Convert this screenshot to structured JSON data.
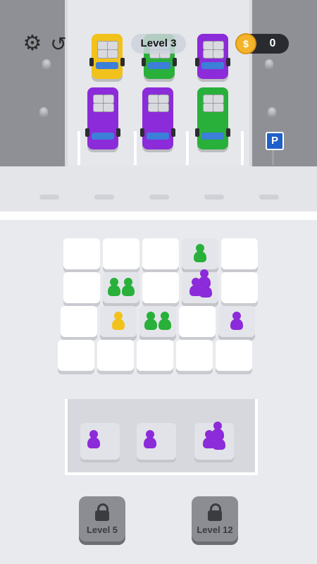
{
  "hud": {
    "settings_icon": "gear-icon",
    "undo_icon": "undo-icon",
    "level": "Level 3",
    "coin_icon": "coin-icon",
    "coin_symbol": "$",
    "coins": "0"
  },
  "parking_sign": "P",
  "cars": [
    {
      "color": "yellow",
      "slot": "left-back"
    },
    {
      "color": "green",
      "slot": "middle-back"
    },
    {
      "color": "purple",
      "slot": "right-back"
    },
    {
      "color": "purple",
      "slot": "left-front"
    },
    {
      "color": "purple",
      "slot": "middle-front"
    },
    {
      "color": "green",
      "slot": "right-front"
    }
  ],
  "colors": {
    "green": "#29b03a",
    "purple": "#8c2bd9",
    "yellow": "#f2c21c",
    "coin": "#f4b42a",
    "window": "#3b7fd9",
    "parking_sign": "#1f5fc9"
  },
  "grid": {
    "rows": 4,
    "cols": 5,
    "crowds": [
      {
        "row": 0,
        "col": 3,
        "color": "green",
        "count": 1
      },
      {
        "row": 1,
        "col": 1,
        "color": "green",
        "count": 2
      },
      {
        "row": 1,
        "col": 3,
        "color": "purple",
        "count": 3
      },
      {
        "row": 2,
        "col": 1,
        "color": "yellow",
        "count": 1
      },
      {
        "row": 2,
        "col": 2,
        "color": "green",
        "count": 2
      },
      {
        "row": 2,
        "col": 4,
        "color": "purple",
        "count": 1
      }
    ]
  },
  "queue": [
    {
      "color": "purple",
      "count": 1
    },
    {
      "color": "purple",
      "count": 1
    },
    {
      "color": "purple",
      "count": 3
    }
  ],
  "locked_slots": [
    {
      "label": "Level 5"
    },
    {
      "label": "Level 12"
    }
  ]
}
